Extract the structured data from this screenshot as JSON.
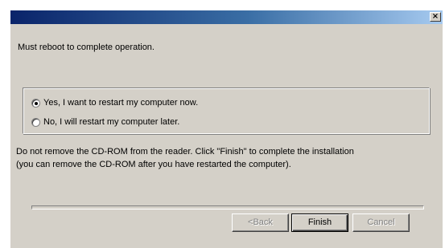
{
  "window": {
    "title": "",
    "close_glyph": "×"
  },
  "main": {
    "message": "Must reboot to complete operation.",
    "options": [
      {
        "label": "Yes, I want to restart my computer now.",
        "selected": true
      },
      {
        "label": "No, I will restart my computer later.",
        "selected": false
      }
    ],
    "note_line1": "Do not remove the CD-ROM from the reader. Click \"Finish\" to complete the installation",
    "note_line2": "(you can remove the CD-ROM after you have restarted the computer)."
  },
  "buttons": {
    "back_label": "<Back",
    "finish_label": "Finish",
    "cancel_label": "Cancel",
    "back_enabled": false,
    "finish_enabled": true,
    "cancel_enabled": false
  },
  "colors": {
    "titlebar_start": "#0a246a",
    "titlebar_end": "#a6caf0",
    "face": "#d4d0c8",
    "disabled_text": "#808080"
  },
  "icons": {
    "close": "close-icon"
  }
}
